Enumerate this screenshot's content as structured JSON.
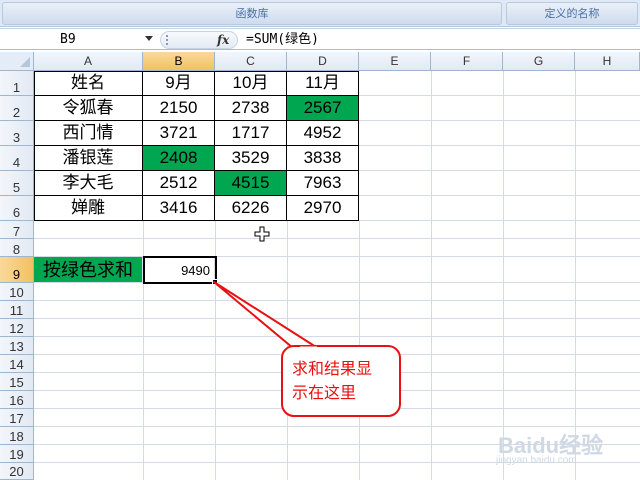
{
  "ribbon": {
    "groups": [
      "函数库",
      "定义的名称"
    ]
  },
  "formula_bar": {
    "name_box": "B9",
    "fx_label": "fx",
    "formula": "=SUM(绿色)"
  },
  "sheet": {
    "columns": [
      "A",
      "B",
      "C",
      "D",
      "E",
      "F",
      "G",
      "H"
    ],
    "selected_column": "B",
    "rows": [
      "1",
      "2",
      "3",
      "4",
      "5",
      "6",
      "7",
      "8",
      "9",
      "10",
      "11",
      "12",
      "13",
      "14",
      "15",
      "16",
      "17",
      "18",
      "19",
      "20"
    ],
    "selected_row": "9",
    "table": [
      [
        "姓名",
        "9月",
        "10月",
        "11月"
      ],
      [
        "令狐春",
        "2150",
        "2738",
        "2567"
      ],
      [
        "西门情",
        "3721",
        "1717",
        "4952"
      ],
      [
        "潘银莲",
        "2408",
        "3529",
        "3838"
      ],
      [
        "李大毛",
        "2512",
        "4515",
        "7963"
      ],
      [
        "婵雕",
        "3416",
        "6226",
        "2970"
      ]
    ],
    "sum_label": "按绿色求和",
    "sum_value": "9490",
    "highlight_color": "#00a650"
  },
  "callout": {
    "line1": "求和结果显",
    "line2": "示在这里",
    "color": "#e81010"
  },
  "watermark": {
    "brand": "Baidu经验",
    "url": "jingyan.baidu.com"
  }
}
